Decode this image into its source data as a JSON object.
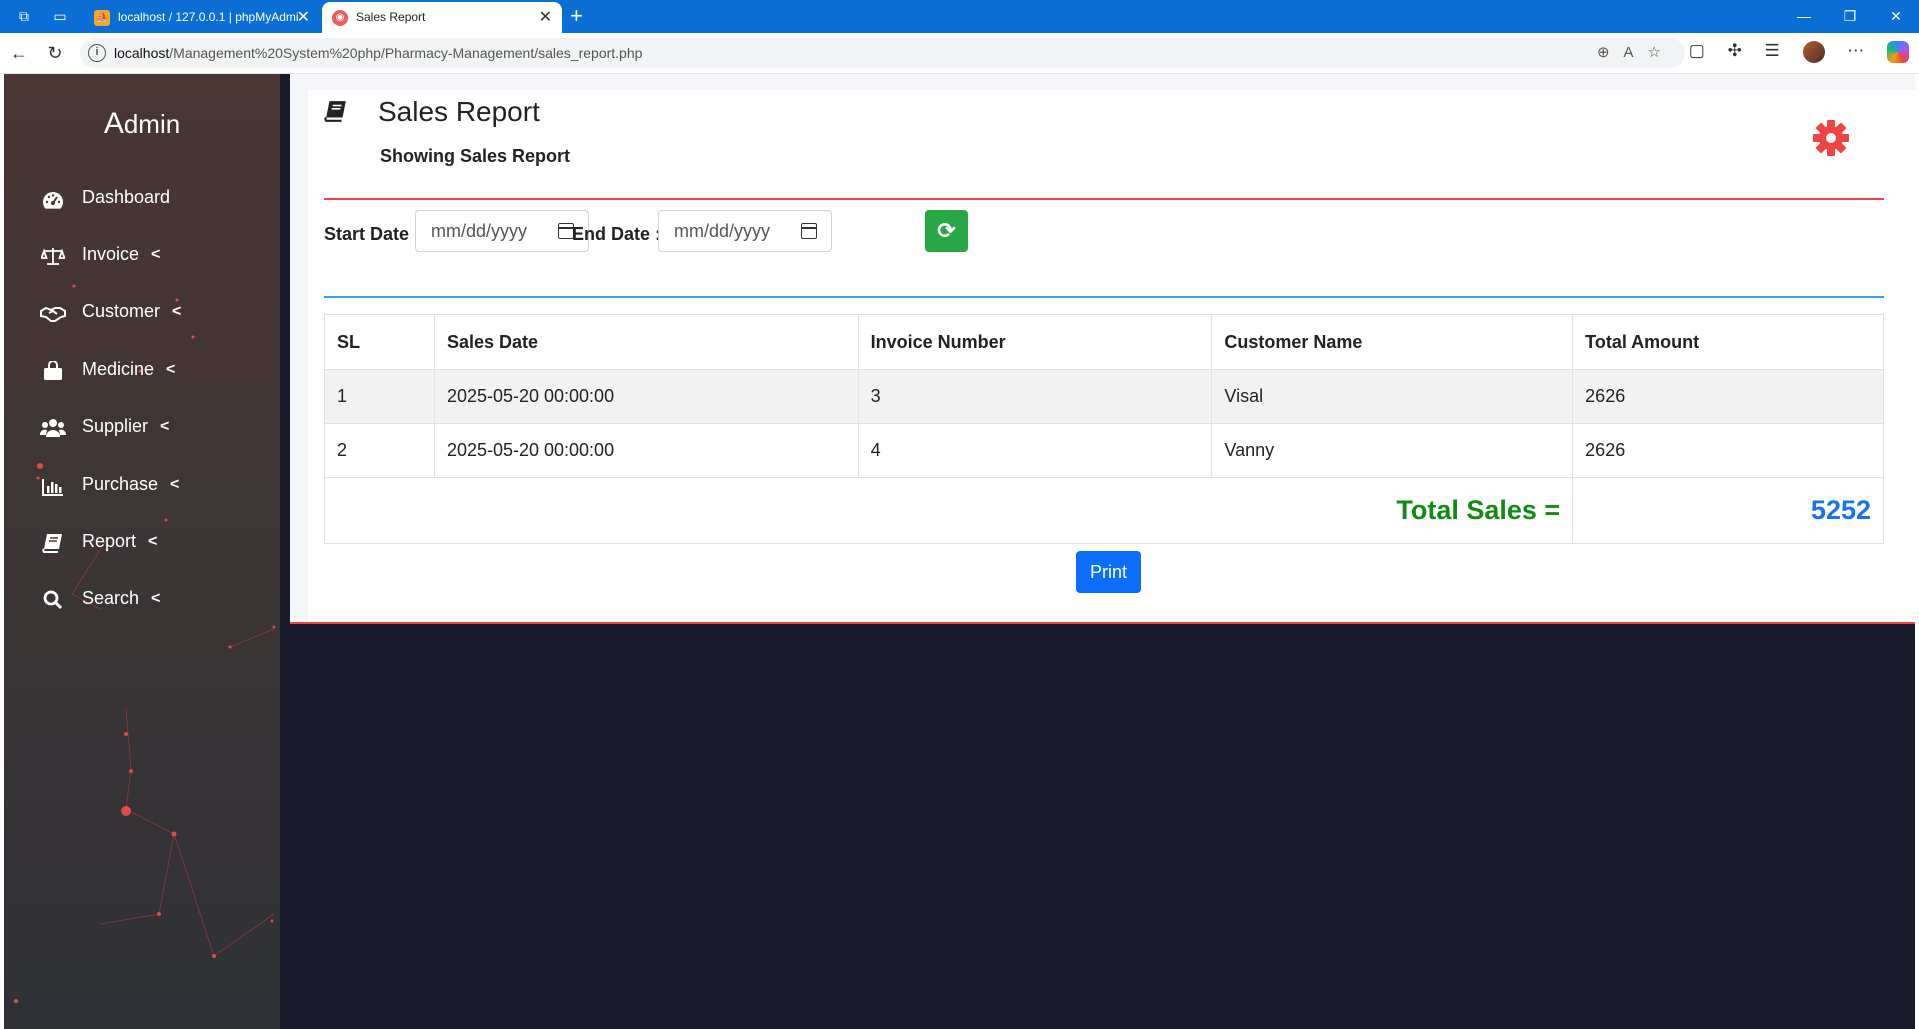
{
  "browser": {
    "tabs": [
      {
        "title": "localhost / 127.0.0.1 | phpMyAdmi",
        "active": false
      },
      {
        "title": "Sales Report",
        "active": true
      }
    ],
    "url_host": "localhost",
    "url_path": "/Management%20System%20php/Pharmacy-Management/sales_report.php"
  },
  "sidebar": {
    "brand_first": "A",
    "brand_rest": "dmin",
    "items": [
      {
        "label": "Dashboard",
        "icon": "dashboard-icon",
        "has_chevron": false
      },
      {
        "label": "Invoice",
        "icon": "scale-icon",
        "has_chevron": true
      },
      {
        "label": "Customer",
        "icon": "handshake-icon",
        "has_chevron": true
      },
      {
        "label": "Medicine",
        "icon": "shopping-bag-icon",
        "has_chevron": true
      },
      {
        "label": "Supplier",
        "icon": "users-icon",
        "has_chevron": true
      },
      {
        "label": "Purchase",
        "icon": "bar-chart-icon",
        "has_chevron": true
      },
      {
        "label": "Report",
        "icon": "book-icon",
        "has_chevron": true
      },
      {
        "label": "Search",
        "icon": "search-icon",
        "has_chevron": true
      }
    ]
  },
  "main": {
    "title": "Sales Report",
    "subtitle": "Showing Sales Report",
    "filters": {
      "start_label": "Start Date :",
      "end_label": "End Date :",
      "start_placeholder": "mm/dd/yyyy",
      "end_placeholder": "mm/dd/yyyy"
    },
    "table": {
      "headers": [
        "SL",
        "Sales Date",
        "Invoice Number",
        "Customer Name",
        "Total Amount"
      ],
      "rows": [
        [
          "1",
          "2025-05-20 00:00:00",
          "3",
          "Visal",
          "2626"
        ],
        [
          "2",
          "2025-05-20 00:00:00",
          "4",
          "Vanny",
          "2626"
        ]
      ],
      "total_label": "Total Sales =",
      "total_value": "5252"
    },
    "print_label": "Print"
  },
  "colors": {
    "accent_red": "#ef4444",
    "accent_blue": "#3ba0e6",
    "refresh_green": "#28a745",
    "print_blue": "#0d6efd",
    "total_green": "#138a13",
    "total_blue": "#1a73e8"
  }
}
